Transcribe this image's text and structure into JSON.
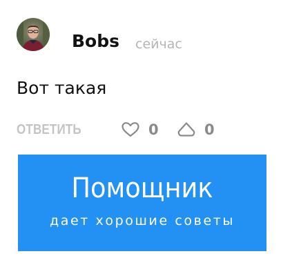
{
  "comment": {
    "author": "Bobs",
    "timestamp": "сейчас",
    "text": "Вот такая",
    "avatar_icon": "user-avatar-photo"
  },
  "actions": {
    "reply_label": "ОТВЕТИТЬ",
    "likes": {
      "icon": "heart-outline-icon",
      "count": "0"
    },
    "upvotes": {
      "icon": "arrow-up-outline-icon",
      "count": "0"
    }
  },
  "banner": {
    "title": "Помощник",
    "subtitle": "дает хорошие советы",
    "background": "#2391f3"
  },
  "colors": {
    "author": "#111111",
    "muted": "#b5b5b5",
    "reply": "#c4c4c4",
    "count": "#8a8a8a"
  }
}
